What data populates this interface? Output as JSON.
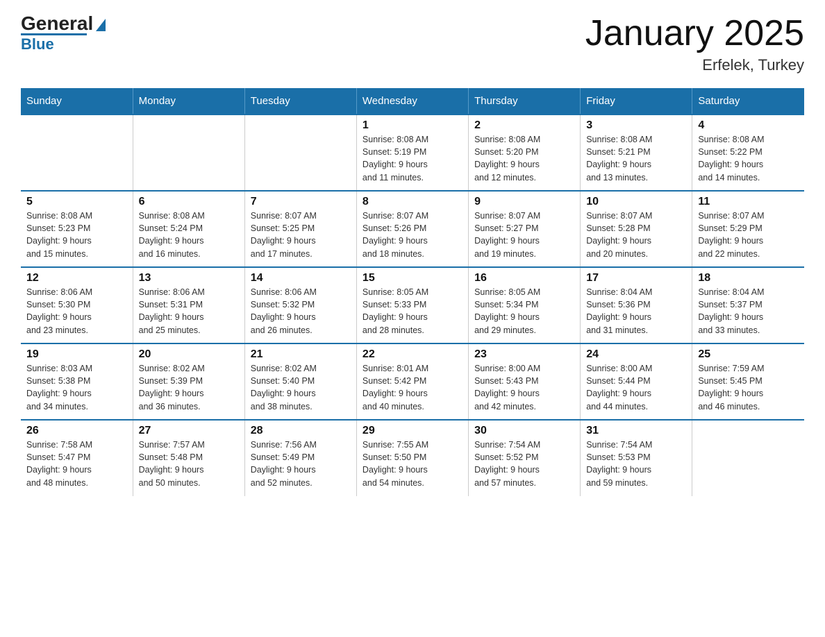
{
  "header": {
    "logo_main": "General",
    "logo_sub": "Blue",
    "title": "January 2025",
    "subtitle": "Erfelek, Turkey"
  },
  "days_of_week": [
    "Sunday",
    "Monday",
    "Tuesday",
    "Wednesday",
    "Thursday",
    "Friday",
    "Saturday"
  ],
  "weeks": [
    [
      {
        "day": "",
        "info": ""
      },
      {
        "day": "",
        "info": ""
      },
      {
        "day": "",
        "info": ""
      },
      {
        "day": "1",
        "info": "Sunrise: 8:08 AM\nSunset: 5:19 PM\nDaylight: 9 hours\nand 11 minutes."
      },
      {
        "day": "2",
        "info": "Sunrise: 8:08 AM\nSunset: 5:20 PM\nDaylight: 9 hours\nand 12 minutes."
      },
      {
        "day": "3",
        "info": "Sunrise: 8:08 AM\nSunset: 5:21 PM\nDaylight: 9 hours\nand 13 minutes."
      },
      {
        "day": "4",
        "info": "Sunrise: 8:08 AM\nSunset: 5:22 PM\nDaylight: 9 hours\nand 14 minutes."
      }
    ],
    [
      {
        "day": "5",
        "info": "Sunrise: 8:08 AM\nSunset: 5:23 PM\nDaylight: 9 hours\nand 15 minutes."
      },
      {
        "day": "6",
        "info": "Sunrise: 8:08 AM\nSunset: 5:24 PM\nDaylight: 9 hours\nand 16 minutes."
      },
      {
        "day": "7",
        "info": "Sunrise: 8:07 AM\nSunset: 5:25 PM\nDaylight: 9 hours\nand 17 minutes."
      },
      {
        "day": "8",
        "info": "Sunrise: 8:07 AM\nSunset: 5:26 PM\nDaylight: 9 hours\nand 18 minutes."
      },
      {
        "day": "9",
        "info": "Sunrise: 8:07 AM\nSunset: 5:27 PM\nDaylight: 9 hours\nand 19 minutes."
      },
      {
        "day": "10",
        "info": "Sunrise: 8:07 AM\nSunset: 5:28 PM\nDaylight: 9 hours\nand 20 minutes."
      },
      {
        "day": "11",
        "info": "Sunrise: 8:07 AM\nSunset: 5:29 PM\nDaylight: 9 hours\nand 22 minutes."
      }
    ],
    [
      {
        "day": "12",
        "info": "Sunrise: 8:06 AM\nSunset: 5:30 PM\nDaylight: 9 hours\nand 23 minutes."
      },
      {
        "day": "13",
        "info": "Sunrise: 8:06 AM\nSunset: 5:31 PM\nDaylight: 9 hours\nand 25 minutes."
      },
      {
        "day": "14",
        "info": "Sunrise: 8:06 AM\nSunset: 5:32 PM\nDaylight: 9 hours\nand 26 minutes."
      },
      {
        "day": "15",
        "info": "Sunrise: 8:05 AM\nSunset: 5:33 PM\nDaylight: 9 hours\nand 28 minutes."
      },
      {
        "day": "16",
        "info": "Sunrise: 8:05 AM\nSunset: 5:34 PM\nDaylight: 9 hours\nand 29 minutes."
      },
      {
        "day": "17",
        "info": "Sunrise: 8:04 AM\nSunset: 5:36 PM\nDaylight: 9 hours\nand 31 minutes."
      },
      {
        "day": "18",
        "info": "Sunrise: 8:04 AM\nSunset: 5:37 PM\nDaylight: 9 hours\nand 33 minutes."
      }
    ],
    [
      {
        "day": "19",
        "info": "Sunrise: 8:03 AM\nSunset: 5:38 PM\nDaylight: 9 hours\nand 34 minutes."
      },
      {
        "day": "20",
        "info": "Sunrise: 8:02 AM\nSunset: 5:39 PM\nDaylight: 9 hours\nand 36 minutes."
      },
      {
        "day": "21",
        "info": "Sunrise: 8:02 AM\nSunset: 5:40 PM\nDaylight: 9 hours\nand 38 minutes."
      },
      {
        "day": "22",
        "info": "Sunrise: 8:01 AM\nSunset: 5:42 PM\nDaylight: 9 hours\nand 40 minutes."
      },
      {
        "day": "23",
        "info": "Sunrise: 8:00 AM\nSunset: 5:43 PM\nDaylight: 9 hours\nand 42 minutes."
      },
      {
        "day": "24",
        "info": "Sunrise: 8:00 AM\nSunset: 5:44 PM\nDaylight: 9 hours\nand 44 minutes."
      },
      {
        "day": "25",
        "info": "Sunrise: 7:59 AM\nSunset: 5:45 PM\nDaylight: 9 hours\nand 46 minutes."
      }
    ],
    [
      {
        "day": "26",
        "info": "Sunrise: 7:58 AM\nSunset: 5:47 PM\nDaylight: 9 hours\nand 48 minutes."
      },
      {
        "day": "27",
        "info": "Sunrise: 7:57 AM\nSunset: 5:48 PM\nDaylight: 9 hours\nand 50 minutes."
      },
      {
        "day": "28",
        "info": "Sunrise: 7:56 AM\nSunset: 5:49 PM\nDaylight: 9 hours\nand 52 minutes."
      },
      {
        "day": "29",
        "info": "Sunrise: 7:55 AM\nSunset: 5:50 PM\nDaylight: 9 hours\nand 54 minutes."
      },
      {
        "day": "30",
        "info": "Sunrise: 7:54 AM\nSunset: 5:52 PM\nDaylight: 9 hours\nand 57 minutes."
      },
      {
        "day": "31",
        "info": "Sunrise: 7:54 AM\nSunset: 5:53 PM\nDaylight: 9 hours\nand 59 minutes."
      },
      {
        "day": "",
        "info": ""
      }
    ]
  ]
}
